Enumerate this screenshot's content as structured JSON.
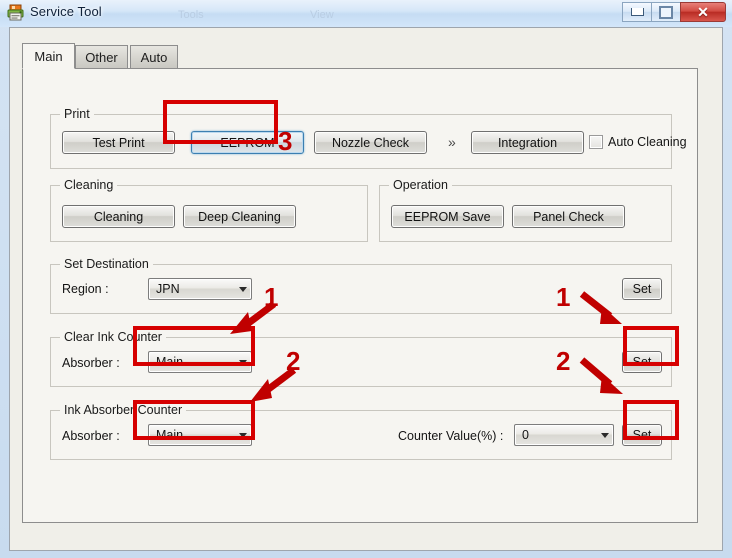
{
  "window": {
    "title": "Service Tool",
    "icon": "printer-icon",
    "ghost_labels": [
      "Tools",
      "View"
    ],
    "controls": {
      "minimize": "minimize-button",
      "maximize": "maximize-button",
      "close_label": "✕"
    }
  },
  "tabs": [
    {
      "label": "Main",
      "active": true
    },
    {
      "label": "Other",
      "active": false
    },
    {
      "label": "Auto",
      "active": false
    }
  ],
  "groups": {
    "print": {
      "label": "Print",
      "buttons": [
        {
          "label": "Test Print",
          "focused": false
        },
        {
          "label": "EEPROM",
          "focused": true
        },
        {
          "label": "Nozzle Check",
          "focused": false
        },
        {
          "label": "Integration",
          "focused": false
        }
      ],
      "separator": "»",
      "checkbox": {
        "label": "Auto Cleaning",
        "checked": false
      }
    },
    "cleaning": {
      "label": "Cleaning",
      "buttons": [
        {
          "label": "Cleaning"
        },
        {
          "label": "Deep Cleaning"
        }
      ]
    },
    "operation": {
      "label": "Operation",
      "buttons": [
        {
          "label": "EEPROM Save"
        },
        {
          "label": "Panel Check"
        }
      ]
    },
    "set_destination": {
      "label": "Set Destination",
      "field_label": "Region :",
      "region_value": "JPN",
      "set_button": "Set"
    },
    "clear_ink_counter": {
      "label": "Clear Ink Counter",
      "field_label": "Absorber :",
      "absorber_value": "Main",
      "set_button": "Set"
    },
    "ink_absorber_counter": {
      "label": "Ink Absorber Counter",
      "field_label": "Absorber :",
      "absorber_value": "Main",
      "counter_label": "Counter Value(%) :",
      "counter_value": "0",
      "set_button": "Set"
    }
  },
  "annotations": {
    "color": "#d60000",
    "steps": [
      {
        "number": "1",
        "target": "clear-ink-counter-absorber-combo"
      },
      {
        "number": "1",
        "target": "clear-ink-counter-set-button"
      },
      {
        "number": "2",
        "target": "ink-absorber-counter-absorber-combo"
      },
      {
        "number": "2",
        "target": "ink-absorber-counter-set-button"
      },
      {
        "number": "3",
        "target": "eeprom-button"
      }
    ],
    "labels": {
      "step1_left": "1",
      "step1_right": "1",
      "step2_left": "2",
      "step2_right": "2",
      "step3": "3"
    }
  }
}
